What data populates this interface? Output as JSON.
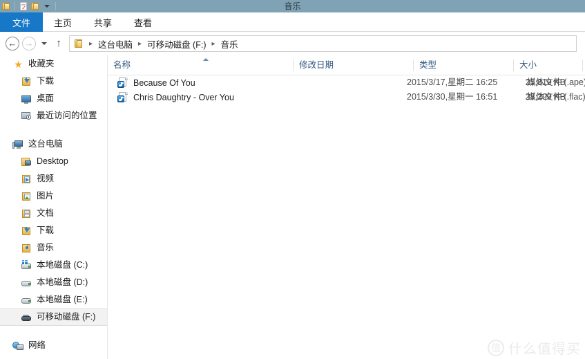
{
  "titlebar": {
    "title": "音乐",
    "quick_access": [
      {
        "name": "folder-icon",
        "label": "属性"
      },
      {
        "name": "new-folder-icon",
        "label": "新建文件夹"
      },
      {
        "name": "folder-open-icon",
        "label": "打开"
      },
      {
        "name": "customize-chevron-icon",
        "label": "自定义快速访问工具栏"
      }
    ]
  },
  "ribbon": {
    "tabs": [
      {
        "label": "文件",
        "active": true
      },
      {
        "label": "主页",
        "active": false
      },
      {
        "label": "共享",
        "active": false
      },
      {
        "label": "查看",
        "active": false
      }
    ]
  },
  "address": {
    "back_label": "后退",
    "forward_label": "前进",
    "recent_label": "最近浏览的位置",
    "up_label": "上移到",
    "crumbs": [
      "这台电脑",
      "可移动磁盘 (F:)",
      "音乐"
    ],
    "separator": "▸"
  },
  "nav": {
    "groups": [
      {
        "root": {
          "label": "收藏夹",
          "icon": "star-icon"
        },
        "items": [
          {
            "label": "下载",
            "icon": "download-folder-icon"
          },
          {
            "label": "桌面",
            "icon": "desktop-icon"
          },
          {
            "label": "最近访问的位置",
            "icon": "recent-places-icon"
          }
        ]
      },
      {
        "root": {
          "label": "这台电脑",
          "icon": "this-pc-icon"
        },
        "items": [
          {
            "label": "Desktop",
            "icon": "desktop-folder-icon"
          },
          {
            "label": "视频",
            "icon": "videos-folder-icon"
          },
          {
            "label": "图片",
            "icon": "pictures-folder-icon"
          },
          {
            "label": "文档",
            "icon": "documents-folder-icon"
          },
          {
            "label": "下载",
            "icon": "download-folder-icon"
          },
          {
            "label": "音乐",
            "icon": "music-folder-icon"
          },
          {
            "label": "本地磁盘 (C:)",
            "icon": "system-drive-icon"
          },
          {
            "label": "本地磁盘 (D:)",
            "icon": "hard-drive-icon"
          },
          {
            "label": "本地磁盘 (E:)",
            "icon": "hard-drive-icon"
          },
          {
            "label": "可移动磁盘 (F:)",
            "icon": "removable-drive-icon",
            "selected": true
          }
        ]
      },
      {
        "root": {
          "label": "网络",
          "icon": "network-icon"
        },
        "items": []
      }
    ]
  },
  "columns": [
    {
      "label": "名称",
      "sorted": "asc"
    },
    {
      "label": "修改日期",
      "sorted": ""
    },
    {
      "label": "类型",
      "sorted": ""
    },
    {
      "label": "大小",
      "sorted": ""
    }
  ],
  "files": [
    {
      "name": "Because Of You",
      "icon": "media-file-icon",
      "date": "2015/3/17,星期二 16:25",
      "type": "媒体文件 (.ape)",
      "size": "25,819 KB"
    },
    {
      "name": "Chris Daughtry - Over You",
      "icon": "media-file-icon",
      "date": "2015/3/30,星期一 16:51",
      "type": "媒体文件 (.flac)",
      "size": "28,299 KB"
    }
  ],
  "watermark": {
    "mark": "值",
    "text": "什么值得买"
  },
  "colors": {
    "titlebar": "#7fa2b4",
    "file_tab": "#1878c8",
    "column_header_text": "#31577e",
    "selection": "#f2f2f2",
    "watermark": "#ebebeb"
  }
}
